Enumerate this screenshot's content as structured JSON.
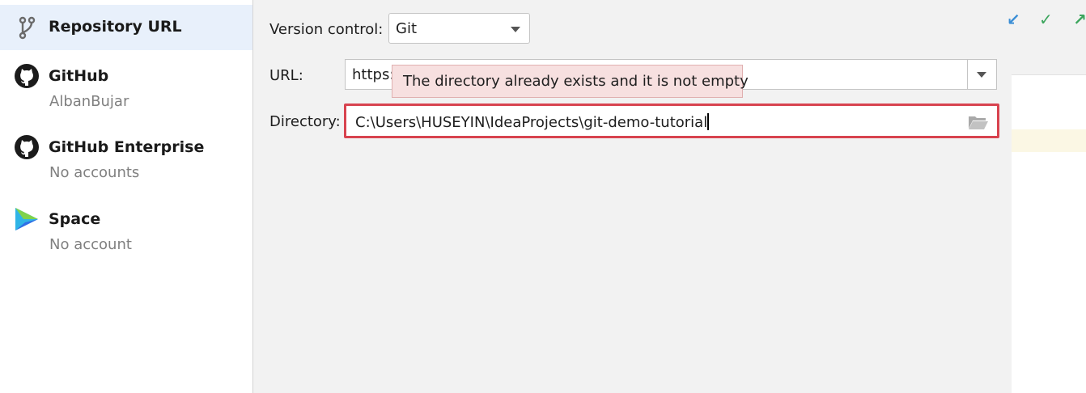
{
  "sidebar": {
    "items": [
      {
        "title": "Repository URL",
        "subtitle": "",
        "icon": "vcs-branch-icon"
      },
      {
        "title": "GitHub",
        "subtitle": "AlbanBujar",
        "icon": "github-icon"
      },
      {
        "title": "GitHub Enterprise",
        "subtitle": "No accounts",
        "icon": "github-icon"
      },
      {
        "title": "Space",
        "subtitle": "No account",
        "icon": "space-icon"
      }
    ]
  },
  "form": {
    "version_control_label": "Version control:",
    "version_control_value": "Git",
    "url_label": "URL:",
    "url_value": "https:",
    "directory_label": "Directory:",
    "directory_value": "C:\\Users\\HUSEYIN\\IdeaProjects\\git-demo-tutorial",
    "error_tooltip": "The directory already exists and it is not empty"
  },
  "colors": {
    "selected_bg": "#e8f0fb",
    "error_border": "#d8434f",
    "tooltip_bg": "#f7e0e0",
    "check_green": "#3ba55c",
    "accent_blue": "#3c8fd6"
  }
}
